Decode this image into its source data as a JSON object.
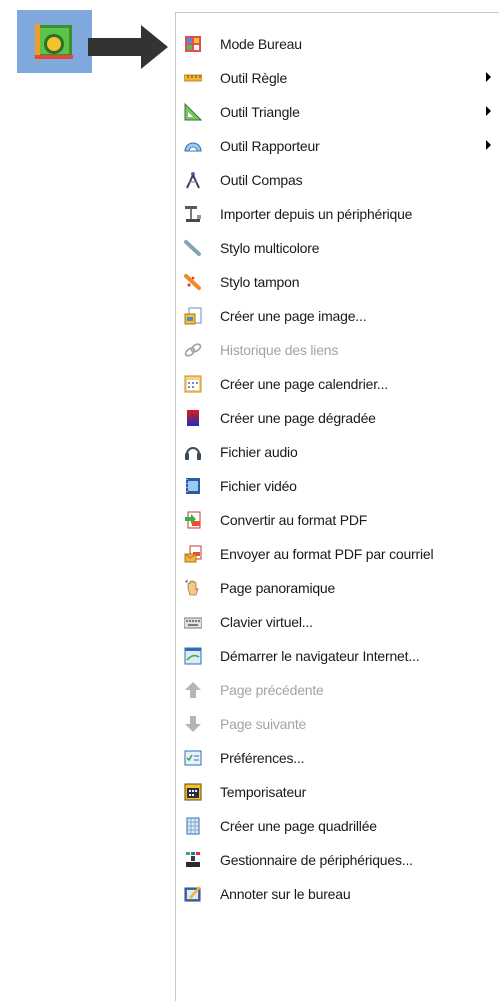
{
  "launcher": {
    "icon": "smartboard-app-icon",
    "background": "#7fa9dc"
  },
  "pointer": {
    "icon": "arrow-right-icon"
  },
  "menu": {
    "items": [
      {
        "label": "Mode Bureau",
        "icon": "desktop-mode-icon",
        "enabled": true,
        "submenu": false
      },
      {
        "label": "Outil Règle",
        "icon": "ruler-icon",
        "enabled": true,
        "submenu": true
      },
      {
        "label": "Outil Triangle",
        "icon": "triangle-icon",
        "enabled": true,
        "submenu": true
      },
      {
        "label": "Outil Rapporteur",
        "icon": "protractor-icon",
        "enabled": true,
        "submenu": true
      },
      {
        "label": "Outil Compas",
        "icon": "compass-icon",
        "enabled": true,
        "submenu": false
      },
      {
        "label": "Importer depuis un périphérique",
        "icon": "import-device-icon",
        "enabled": true,
        "submenu": false
      },
      {
        "label": "Stylo multicolore",
        "icon": "multicolor-pen-icon",
        "enabled": true,
        "submenu": false
      },
      {
        "label": "Stylo tampon",
        "icon": "stamp-pen-icon",
        "enabled": true,
        "submenu": false
      },
      {
        "label": "Créer une page image...",
        "icon": "image-page-icon",
        "enabled": true,
        "submenu": false
      },
      {
        "label": "Historique des liens",
        "icon": "link-history-icon",
        "enabled": false,
        "submenu": false
      },
      {
        "label": "Créer une page calendrier...",
        "icon": "calendar-page-icon",
        "enabled": true,
        "submenu": false
      },
      {
        "label": "Créer une page dégradée",
        "icon": "gradient-page-icon",
        "enabled": true,
        "submenu": false
      },
      {
        "label": "Fichier audio",
        "icon": "headphones-icon",
        "enabled": true,
        "submenu": false
      },
      {
        "label": "Fichier vidéo",
        "icon": "video-file-icon",
        "enabled": true,
        "submenu": false
      },
      {
        "label": "Convertir au format PDF",
        "icon": "convert-pdf-icon",
        "enabled": true,
        "submenu": false
      },
      {
        "label": "Envoyer au format PDF par courriel",
        "icon": "email-pdf-icon",
        "enabled": true,
        "submenu": false
      },
      {
        "label": "Page panoramique",
        "icon": "pan-hand-icon",
        "enabled": true,
        "submenu": false
      },
      {
        "label": "Clavier virtuel...",
        "icon": "keyboard-icon",
        "enabled": true,
        "submenu": false
      },
      {
        "label": "Démarrer le navigateur Internet...",
        "icon": "browser-icon",
        "enabled": true,
        "submenu": false
      },
      {
        "label": "Page précédente",
        "icon": "arrow-up-icon",
        "enabled": false,
        "submenu": false
      },
      {
        "label": "Page suivante",
        "icon": "arrow-down-icon",
        "enabled": false,
        "submenu": false
      },
      {
        "label": "Préférences...",
        "icon": "preferences-icon",
        "enabled": true,
        "submenu": false
      },
      {
        "label": "Temporisateur",
        "icon": "timer-icon",
        "enabled": true,
        "submenu": false
      },
      {
        "label": "Créer une page quadrillée",
        "icon": "grid-page-icon",
        "enabled": true,
        "submenu": false
      },
      {
        "label": "Gestionnaire de périphériques...",
        "icon": "device-manager-icon",
        "enabled": true,
        "submenu": false
      },
      {
        "label": "Annoter sur le bureau",
        "icon": "annotate-desktop-icon",
        "enabled": true,
        "submenu": false
      }
    ]
  }
}
